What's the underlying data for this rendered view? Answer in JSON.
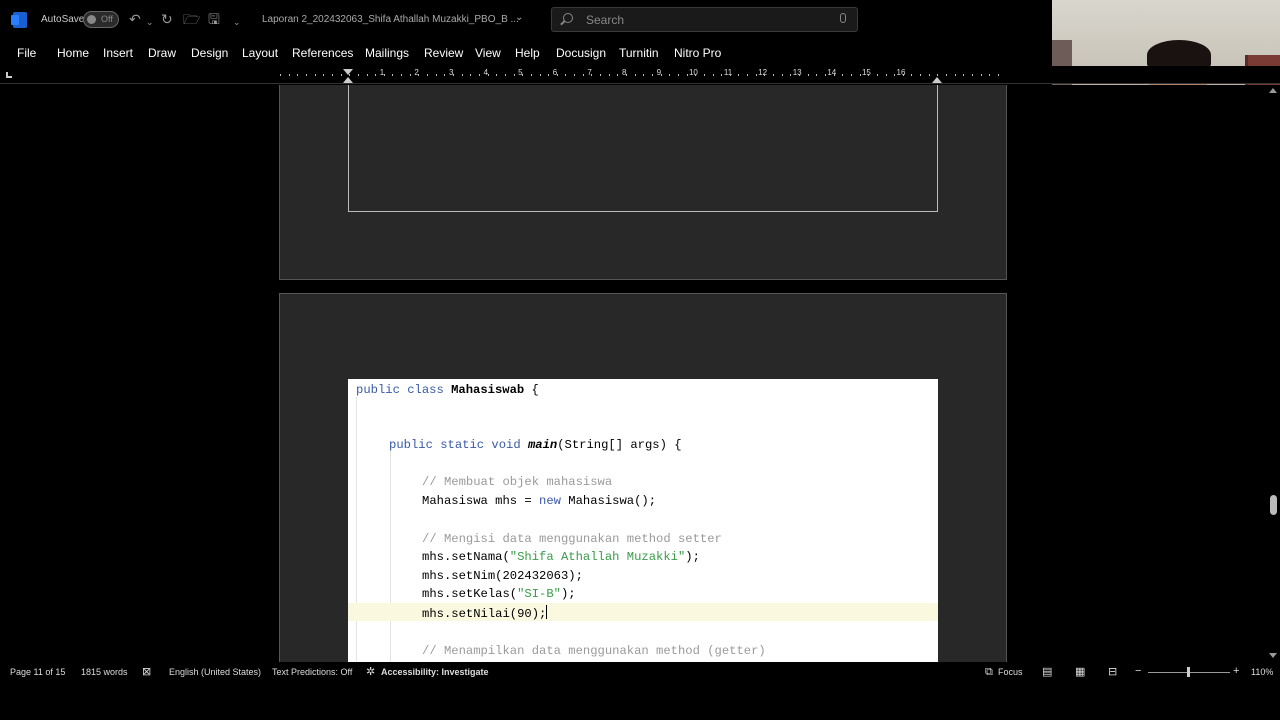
{
  "titlebar": {
    "autosave_label": "AutoSave",
    "autosave_state": "Off",
    "undo_icon": "undo-icon",
    "redo_icon": "redo-icon",
    "document_title": "Laporan 2_202432063_Shifa Athallah Muzakki_PBO_B ...",
    "search_placeholder": "Search"
  },
  "menu": {
    "items": [
      "File",
      "Home",
      "Insert",
      "Draw",
      "Design",
      "Layout",
      "References",
      "Mailings",
      "Review",
      "View",
      "Help",
      "Docusign",
      "Turnitin",
      "Nitro Pro"
    ]
  },
  "ruler": {
    "numbers": [
      "1",
      "2",
      "3",
      "4",
      "5",
      "6",
      "7",
      "8",
      "9",
      "10",
      "11",
      "12",
      "13",
      "14",
      "15",
      "16"
    ]
  },
  "code": {
    "line1_kw": "public class ",
    "line1_name": "Mahasiswab",
    "line1_rest": " {",
    "line2_kw": "public static void ",
    "line2_name": "main",
    "line2_rest": "(String[] args) {",
    "comment1": "// Membuat objek mahasiswa",
    "line3_a": "Mahasiswa mhs = ",
    "line3_kw": "new",
    "line3_b": " Mahasiswa();",
    "comment2": "// Mengisi data menggunakan method setter",
    "line4_a": "mhs.setNama(",
    "line4_str": "\"Shifa Athallah Muzakki\"",
    "line4_b": ");",
    "line5": "mhs.setNim(202432063);",
    "line6_a": "mhs.setKelas(",
    "line6_str": "\"SI-B\"",
    "line6_b": ");",
    "line7": "mhs.setNilai(90);",
    "comment3": "// Menampilkan data menggunakan method (getter)"
  },
  "status": {
    "page": "Page 11 of 15",
    "words": "1815 words",
    "language": "English (United States)",
    "predictions": "Text Predictions: Off",
    "accessibility": "Accessibility: Investigate",
    "focus": "Focus",
    "zoom": "110%"
  }
}
